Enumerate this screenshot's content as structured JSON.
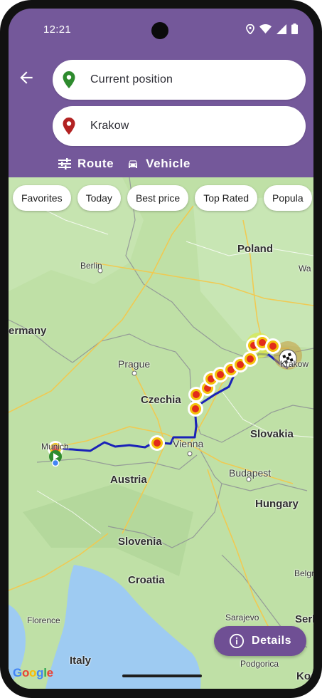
{
  "status_bar": {
    "time": "12:21",
    "icons": [
      "location-icon",
      "wifi-icon",
      "signal-icon",
      "battery-icon"
    ]
  },
  "header": {
    "back_icon": "arrow-left-icon",
    "origin": {
      "value": "Current position",
      "pin_color": "#2e8b2e"
    },
    "destination": {
      "value": "Krakow",
      "pin_color": "#b22222"
    },
    "route_label": "Route",
    "vehicle_label": "Vehicle"
  },
  "filters": [
    "Favorites",
    "Today",
    "Best price",
    "Top Rated",
    "Popula"
  ],
  "map": {
    "countries": [
      "Poland",
      "ermany",
      "Czechia",
      "Slovakia",
      "Austria",
      "Hungary",
      "Slovenia",
      "Croatia",
      "Serl",
      "Kos"
    ],
    "cities": [
      "Berlin",
      "Prague",
      "Vienna",
      "Budapest",
      "Munich",
      "Krakow",
      "Florence",
      "Italy",
      "Sarajevo",
      "Belgrad",
      "Podgorica",
      "Wa"
    ],
    "route_color": "#1a22b8",
    "station_brand": "Shell"
  },
  "details_button": {
    "label": "Details",
    "icon": "info-icon"
  },
  "attribution": "Google",
  "colors": {
    "header": "#74589a",
    "accent": "#6f4f94",
    "map_land": "#bfe0a6",
    "water": "#9ecbf2"
  }
}
